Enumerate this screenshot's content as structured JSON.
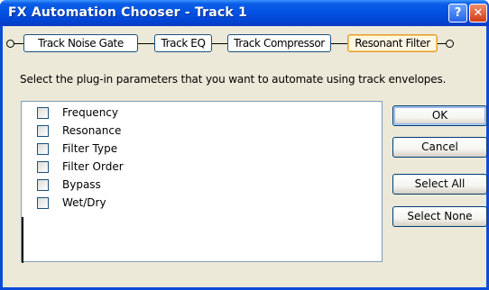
{
  "window": {
    "title": "FX Automation Chooser - Track 1",
    "help_glyph": "?",
    "close_glyph": "✕"
  },
  "fx_chain": [
    "Track Noise Gate",
    "Track EQ",
    "Track Compressor",
    "Resonant Filter"
  ],
  "instruction": "Select the plug-in parameters that you want to automate using track envelopes.",
  "parameters": [
    {
      "label": "Frequency",
      "checked": false
    },
    {
      "label": "Resonance",
      "checked": false
    },
    {
      "label": "Filter Type",
      "checked": false
    },
    {
      "label": "Filter Order",
      "checked": false
    },
    {
      "label": "Bypass",
      "checked": false
    },
    {
      "label": "Wet/Dry",
      "checked": false
    }
  ],
  "buttons": {
    "ok": "OK",
    "cancel": "Cancel",
    "select_all": "Select All",
    "select_none": "Select None"
  },
  "colors": {
    "title_bar": "#0453e4",
    "active_fx_border": "#e09f3a"
  }
}
